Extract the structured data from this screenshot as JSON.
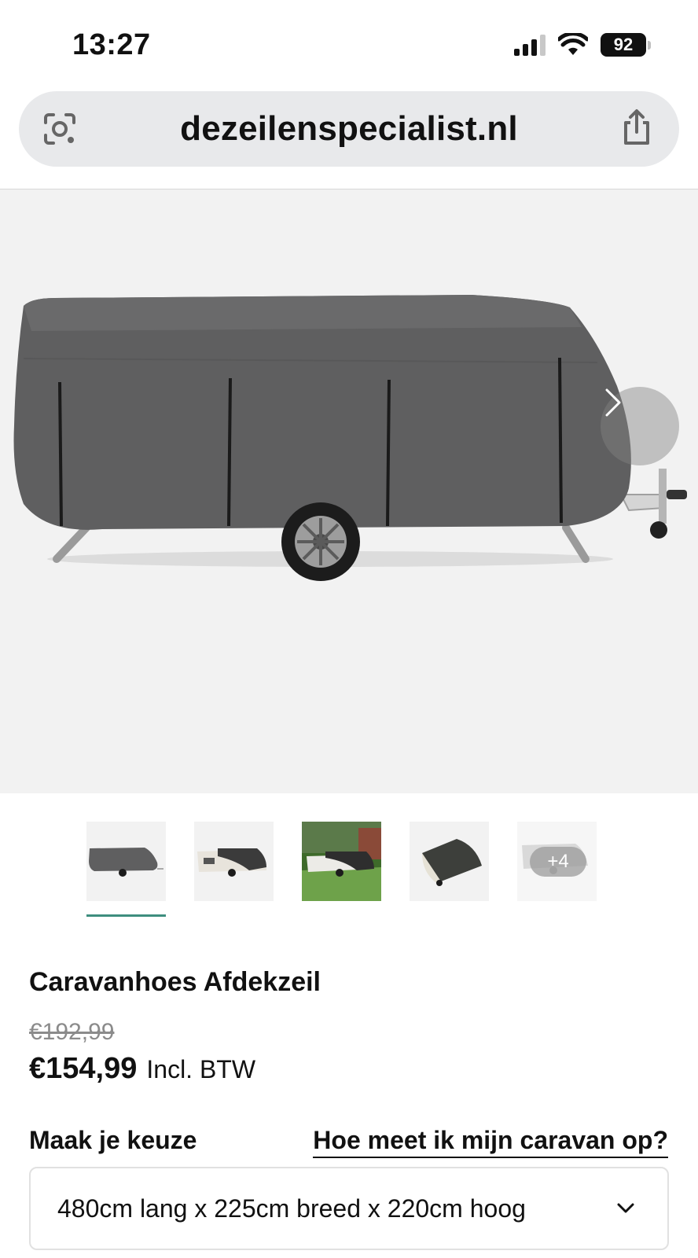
{
  "status_bar": {
    "time": "13:27",
    "battery": "92"
  },
  "browser": {
    "url": "dezeilenspecialist.nl",
    "left_icon": "visual-search-icon",
    "right_icon": "share-icon"
  },
  "gallery": {
    "next_icon": "chevron-right-icon",
    "thumbnails": [
      {
        "name": "thumbnail-1",
        "active": true
      },
      {
        "name": "thumbnail-2",
        "active": false
      },
      {
        "name": "thumbnail-3",
        "active": false
      },
      {
        "name": "thumbnail-4",
        "active": false
      },
      {
        "name": "thumbnail-5",
        "active": false
      }
    ],
    "more_count": "+4",
    "active_color": "#3e8e7e"
  },
  "product": {
    "title": "Caravanhoes Afdekzeil",
    "old_price": "€192,99",
    "price": "€154,99",
    "price_suffix": "Incl. BTW"
  },
  "options": {
    "label": "Maak je keuze",
    "help_link": "Hoe meet ik mijn caravan op?",
    "selected_value": "480cm lang x 225cm breed x 220cm hoog",
    "chevron_icon": "chevron-down-icon"
  }
}
